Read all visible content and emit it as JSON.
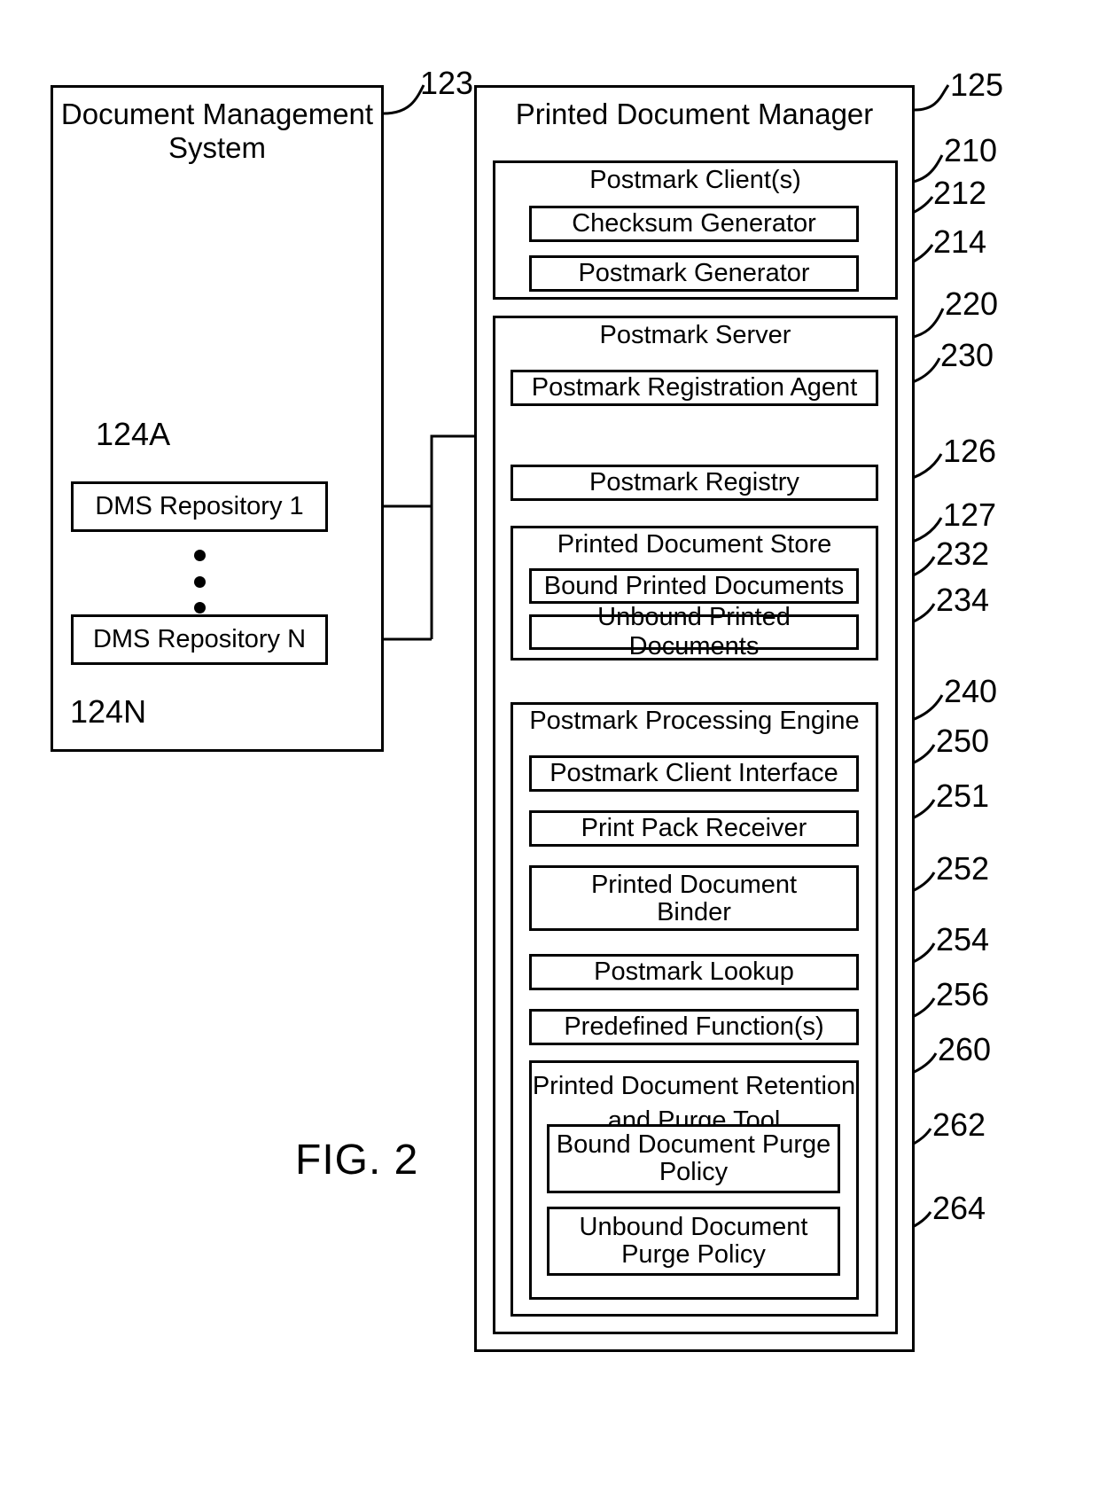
{
  "figure": {
    "label": "FIG. 2"
  },
  "dms": {
    "title_line1": "Document Management",
    "title_line2": "System",
    "ref": "123",
    "repositories": [
      {
        "label": "DMS Repository 1",
        "ref": "124A"
      },
      {
        "label": "DMS Repository N",
        "ref": "124N"
      }
    ],
    "ellipsis_icon": "vertical-ellipsis-icon"
  },
  "pdm": {
    "title": "Printed Document Manager",
    "ref": "125",
    "postmark_clients": {
      "title": "Postmark Client(s)",
      "ref": "210",
      "children": [
        {
          "label": "Checksum Generator",
          "ref": "212"
        },
        {
          "label": "Postmark Generator",
          "ref": "214"
        }
      ]
    },
    "postmark_server": {
      "title": "Postmark Server",
      "ref": "220",
      "registration_agent": {
        "label": "Postmark Registration Agent",
        "ref": "230"
      },
      "registry": {
        "label": "Postmark Registry",
        "ref": "126"
      },
      "printed_document_store": {
        "title": "Printed Document Store",
        "ref": "127",
        "children": [
          {
            "label": "Bound Printed Documents",
            "ref": "232"
          },
          {
            "label": "Unbound Printed Documents",
            "ref": "234"
          }
        ]
      },
      "processing_engine": {
        "title": "Postmark Processing Engine",
        "ref": "240",
        "children": [
          {
            "label": "Postmark Client Interface",
            "ref": "250"
          },
          {
            "label": "Print Pack Receiver",
            "ref": "251"
          },
          {
            "label": "Printed Document Binder",
            "label_line1": "Printed Document",
            "label_line2": "Binder",
            "ref": "252"
          },
          {
            "label": "Postmark Lookup",
            "ref": "254"
          },
          {
            "label": "Predefined Function(s)",
            "ref": "256"
          }
        ],
        "retention_purge_tool": {
          "title_line1": "Printed Document Retention",
          "title_line2": "and Purge Tool",
          "ref": "260",
          "children": [
            {
              "label_line1": "Bound Document Purge",
              "label_line2": "Policy",
              "ref": "262"
            },
            {
              "label_line1": "Unbound Document",
              "label_line2": "Purge Policy",
              "ref": "264"
            }
          ]
        }
      }
    }
  },
  "colors": {
    "stroke": "#000000",
    "background": "#ffffff"
  }
}
